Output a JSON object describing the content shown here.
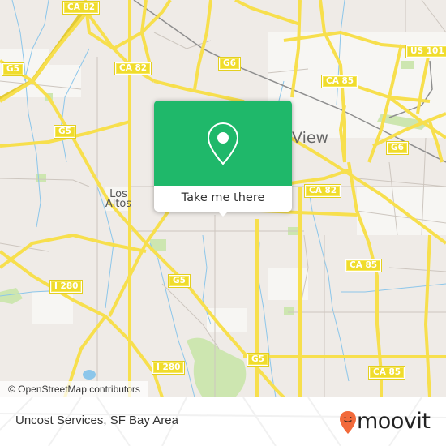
{
  "map": {
    "colors": {
      "land": "#efebe7",
      "road": "#f7df4d",
      "road_casing": "#e8cf3a",
      "minor_road": "#c8c2bd",
      "water": "#7fc0e8",
      "park": "#cde6b0",
      "urban": "#f7f6f3",
      "rail": "#8a8a8a"
    },
    "shields": [
      {
        "id": "ca82-top",
        "label": "CA 82"
      },
      {
        "id": "g5-left",
        "label": "G5"
      },
      {
        "id": "ca82-mid",
        "label": "CA 82"
      },
      {
        "id": "g6-top",
        "label": "G6"
      },
      {
        "id": "us101",
        "label": "US 101"
      },
      {
        "id": "ca85-top",
        "label": "CA 85"
      },
      {
        "id": "g5-mid",
        "label": "G5"
      },
      {
        "id": "g6-right",
        "label": "G6"
      },
      {
        "id": "ca82-right",
        "label": "CA 82"
      },
      {
        "id": "i280-left",
        "label": "I 280"
      },
      {
        "id": "g5-center",
        "label": "G5"
      },
      {
        "id": "ca85-mid",
        "label": "CA 85"
      },
      {
        "id": "i280-bottom",
        "label": "I 280"
      },
      {
        "id": "g5-bottom",
        "label": "G5"
      },
      {
        "id": "ca85-bottom",
        "label": "CA 85"
      }
    ],
    "places": [
      {
        "id": "los-altos",
        "label": "Los\nAltos"
      },
      {
        "id": "mountain-view",
        "label": "View"
      }
    ],
    "attribution": "© OpenStreetMap contributors"
  },
  "popup": {
    "icon": "location-pin-icon",
    "button_label": "Take me there",
    "color": "#1fb86a"
  },
  "footer": {
    "title": "Uncost Services, SF Bay Area",
    "brand": "moovit",
    "brand_color": "#f26a3b"
  }
}
